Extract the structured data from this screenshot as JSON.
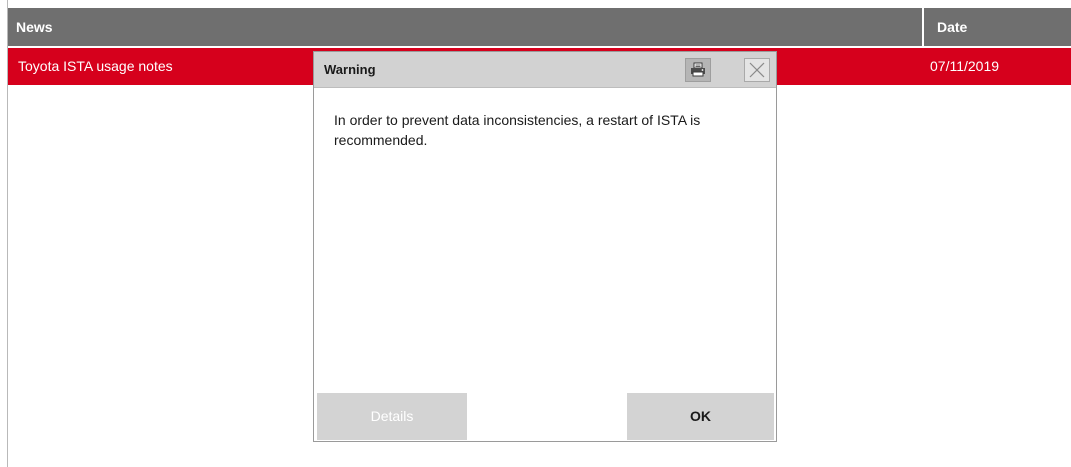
{
  "table": {
    "headers": {
      "news": "News",
      "date": "Date"
    },
    "rows": [
      {
        "title": "Toyota ISTA usage notes",
        "date": "07/11/2019"
      }
    ]
  },
  "dialog": {
    "title": "Warning",
    "print_icon": "printer-icon",
    "close_icon": "close-icon",
    "message": "In order to prevent data inconsistencies, a restart of ISTA is recommended.",
    "buttons": {
      "details": "Details",
      "ok": "OK"
    }
  },
  "colors": {
    "header_bg": "#6f6f6f",
    "selected_row_bg": "#d6001c",
    "dialog_titlebar_bg": "#d2d2d2",
    "button_bg": "#d3d3d3"
  }
}
